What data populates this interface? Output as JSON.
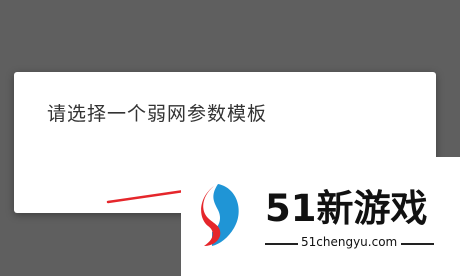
{
  "dialog": {
    "title": "请选择一个弱网参数模板"
  },
  "watermark": {
    "brand": "51新游戏",
    "domain": "51chengyu.com",
    "logo_icon": "51-logo-icon",
    "colors": {
      "red": "#e5262b",
      "blue": "#1f95d6"
    }
  },
  "colors": {
    "overlay": "#5f5f5f",
    "dialog_bg": "#ffffff",
    "text": "#333333"
  }
}
